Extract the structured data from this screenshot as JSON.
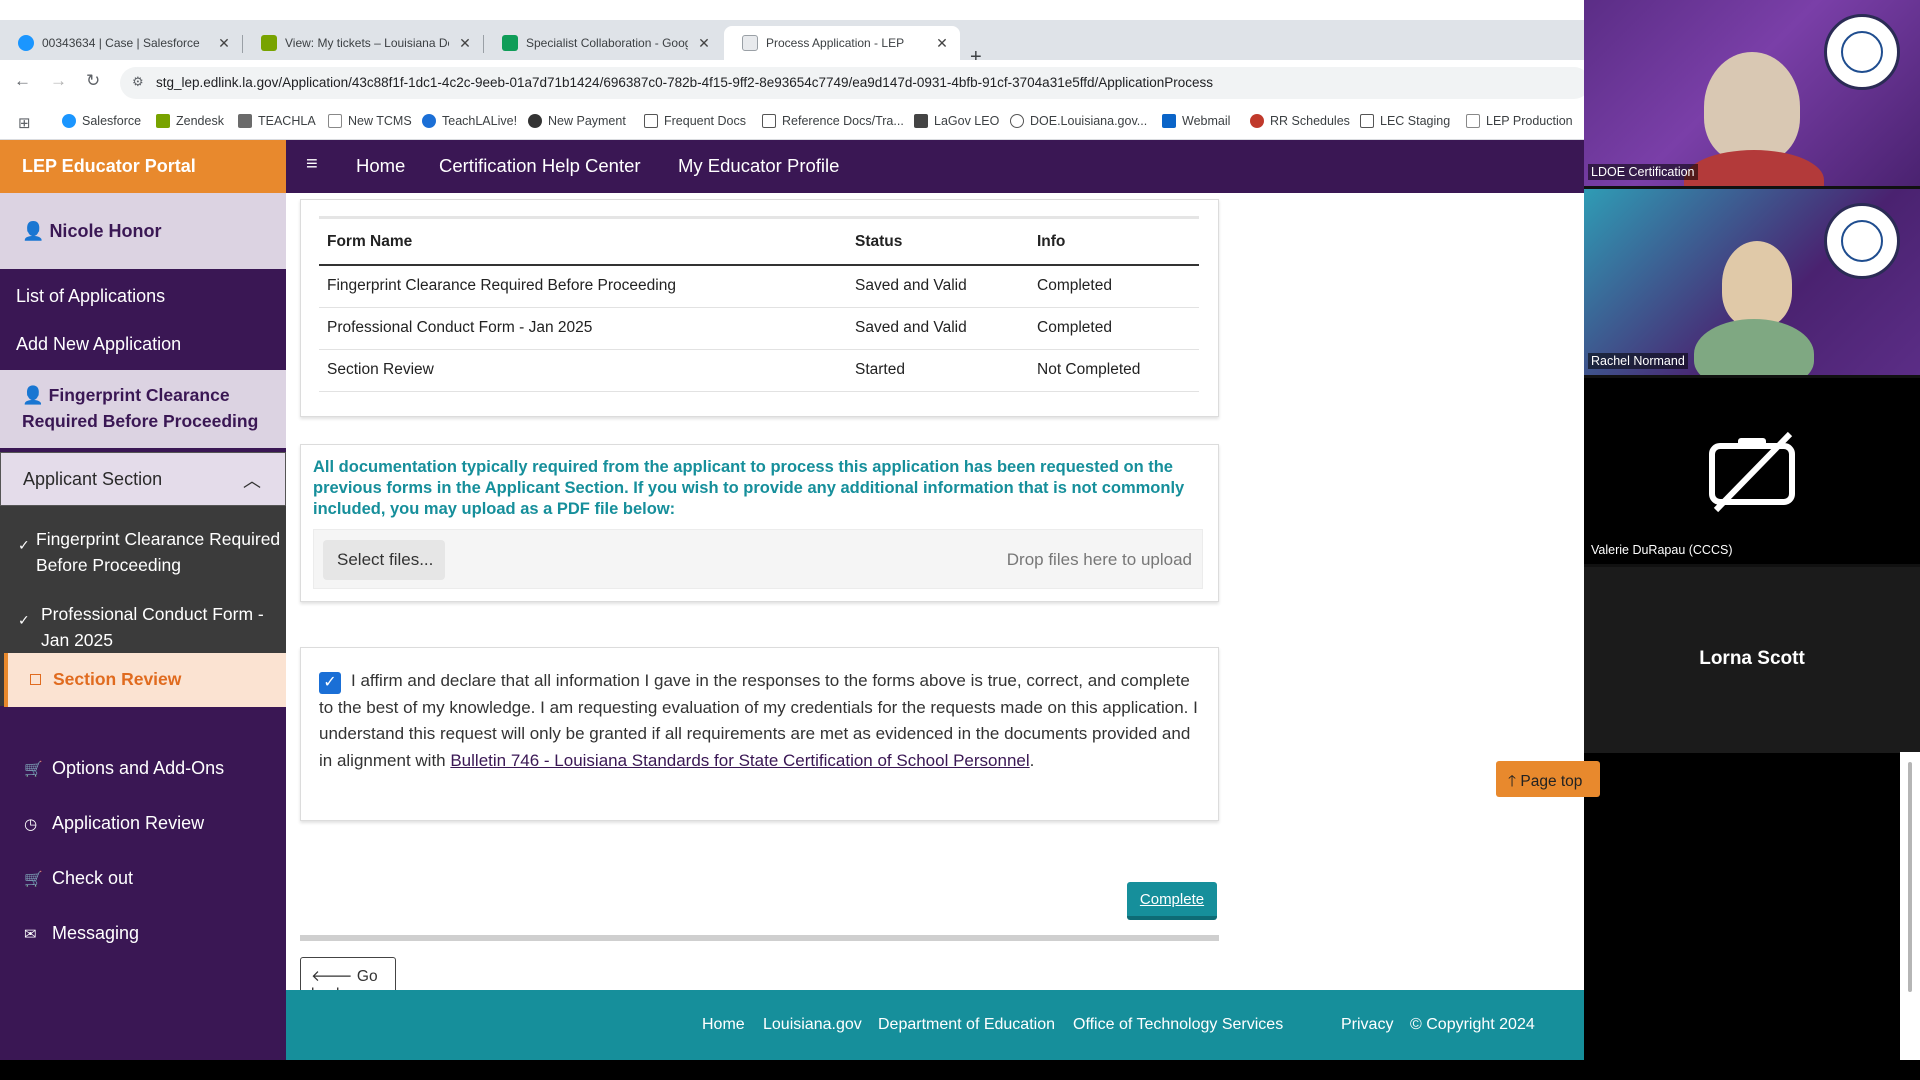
{
  "browser": {
    "tabs": [
      {
        "title": "00343634 | Case | Salesforce",
        "color": "#1b96ff"
      },
      {
        "title": "View: My tickets – Louisiana De",
        "color": "#78a300"
      },
      {
        "title": "Specialist Collaboration - Goog",
        "color": "#0f9d58"
      },
      {
        "title": "Process Application - LEP",
        "color": "#9aa0a6"
      }
    ],
    "url": "stg_lep.edlink.la.gov/Application/43c88f1f-1dc1-4c2c-9eeb-01a7d71b1424/696387c0-782b-4f15-9ff2-8e93654c7749/ea9d147d-0931-4bfb-91cf-3704a31e5ffd/ApplicationProcess",
    "bookmarks": [
      {
        "label": "Salesforce",
        "color": "#1b96ff"
      },
      {
        "label": "Zendesk",
        "color": "#78a300"
      },
      {
        "label": "TEACHLA",
        "color": "#444"
      },
      {
        "label": "New TCMS",
        "color": "#777"
      },
      {
        "label": "TeachLALive!",
        "color": "#1b6fd6"
      },
      {
        "label": "New Payment",
        "color": "#333"
      },
      {
        "label": "Frequent Docs",
        "color": "#555"
      },
      {
        "label": "Reference Docs/Tra...",
        "color": "#555"
      },
      {
        "label": "LaGov LEO",
        "color": "#333"
      },
      {
        "label": "DOE.Louisiana.gov...",
        "color": "#555"
      },
      {
        "label": "Webmail",
        "color": "#0a64c8"
      },
      {
        "label": "RR Schedules",
        "color": "#c0392b"
      },
      {
        "label": "LEC Staging",
        "color": "#555"
      },
      {
        "label": "LEP Production",
        "color": "#888"
      }
    ]
  },
  "portal": {
    "title": "LEP Educator Portal",
    "user": "Nicole Honor",
    "side_links": [
      "List of Applications",
      "Add New Application"
    ],
    "fingerprint_block": "Fingerprint Clearance Required Before Proceeding",
    "applicant_section": "Applicant Section",
    "sub_items": [
      "Fingerprint Clearance Required Before Proceeding",
      "Professional Conduct Form - Jan 2025"
    ],
    "current_item": "Section Review",
    "menu": [
      "Options and Add-Ons",
      "Application Review",
      "Check out",
      "Messaging"
    ],
    "topnav": {
      "home": "Home",
      "help": "Certification Help Center",
      "profile": "My Educator Profile"
    }
  },
  "forms_table": {
    "headers": [
      "Form Name",
      "Status",
      "Info"
    ],
    "rows": [
      [
        "Fingerprint Clearance Required Before Proceeding",
        "Saved and Valid",
        "Completed"
      ],
      [
        "Professional Conduct Form - Jan 2025",
        "Saved and Valid",
        "Completed"
      ],
      [
        "Section Review",
        "Started",
        "Not Completed"
      ]
    ]
  },
  "upload": {
    "instructions": "All documentation typically required from the applicant to process this application has been requested on the previous forms in the Applicant Section. If you wish to provide any additional information that is not commonly included, you may upload as a PDF file below:",
    "select_label": "Select files...",
    "drop_label": "Drop files here to upload"
  },
  "affirm": {
    "checked": true,
    "text": "I affirm and declare that all information I gave in the responses to the forms above is true, correct, and complete to the best of my knowledge.  I am requesting evaluation of my credentials for the requests made on this application. I understand this request will only be granted if all requirements are met as evidenced in the documents provided and in alignment with ",
    "link": "Bulletin 746 - Louisiana Standards for State Certification of School Personnel",
    "end": "."
  },
  "actions": {
    "complete": "Complete",
    "go_back": "Go back",
    "page_top": "Page top"
  },
  "footer": [
    "Home",
    "Louisiana.gov",
    "Department of Education",
    "Office of Technology Services",
    "Privacy",
    "© Copyright 2024"
  ],
  "video_call": {
    "participants": [
      "LDOE Certification",
      "Rachel Normand",
      "Valerie DuRapau (CCCS)",
      "Lorna Scott"
    ]
  },
  "colors": {
    "portal_purple": "#3a1754",
    "portal_orange": "#e8892d",
    "teal": "#168f9b",
    "checkbox_blue": "#1a6fd6"
  }
}
